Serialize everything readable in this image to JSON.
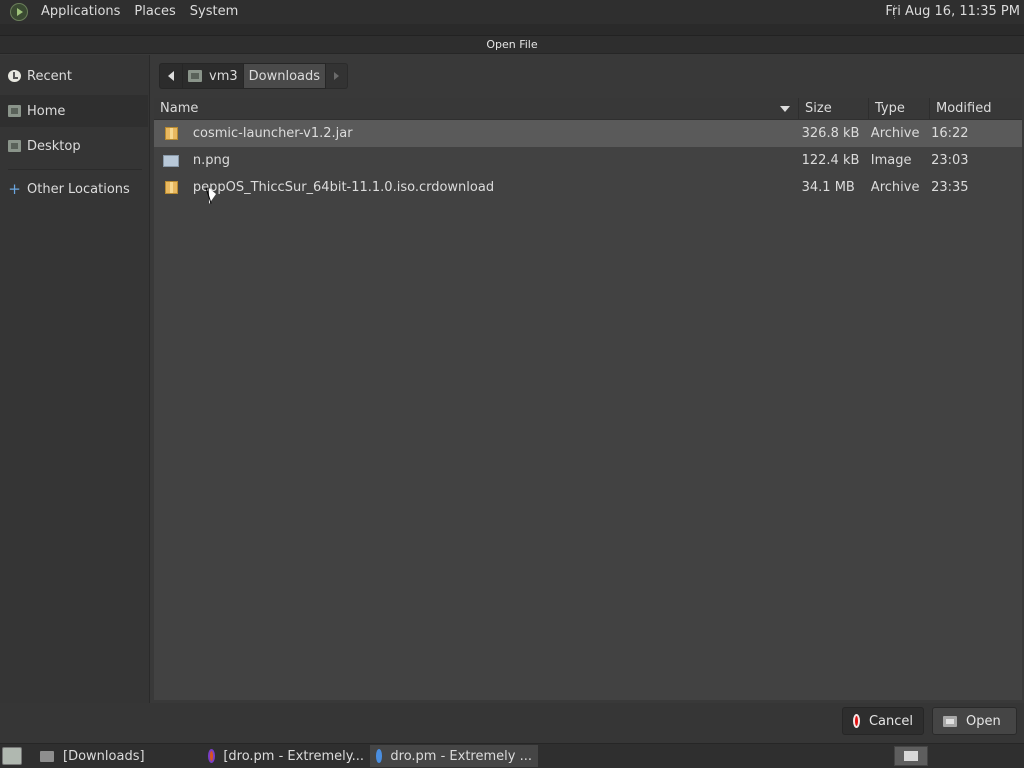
{
  "top_panel": {
    "menus": [
      "Applications",
      "Places",
      "System"
    ],
    "clock": "Fri Aug 16, 11:35 PM"
  },
  "dialog": {
    "title": "Open File",
    "sidebar": {
      "places": [
        {
          "label": "Recent",
          "icon": "clock-icon"
        },
        {
          "label": "Home",
          "icon": "home-folder-icon"
        },
        {
          "label": "Desktop",
          "icon": "desktop-folder-icon"
        },
        {
          "label": "Other Locations",
          "icon": "plus-icon"
        }
      ],
      "active": "Home"
    },
    "pathbar": {
      "segments": [
        "vm3",
        "Downloads"
      ],
      "current": "Downloads"
    },
    "columns": {
      "name": "Name",
      "size": "Size",
      "type": "Type",
      "modified": "Modified"
    },
    "files": [
      {
        "name": "cosmic-launcher-v1.2.jar",
        "size": "326.8 kB",
        "type": "Archive",
        "modified": "16:22",
        "icon": "archive-icon"
      },
      {
        "name": "n.png",
        "size": "122.4 kB",
        "type": "Image",
        "modified": "23:03",
        "icon": "image-icon"
      },
      {
        "name": "peppOS_ThiccSur_64bit-11.1.0.iso.crdownload",
        "size": "34.1 MB",
        "type": "Archive",
        "modified": "23:35",
        "icon": "archive-icon"
      }
    ],
    "buttons": {
      "cancel": "Cancel",
      "open": "Open"
    }
  },
  "taskbar": {
    "tasks": [
      {
        "label": "[Downloads]",
        "icon": "folder-icon"
      },
      {
        "label": "[dro.pm - Extremely...",
        "icon": "firefox-icon"
      },
      {
        "label": "dro.pm - Extremely ...",
        "icon": "chrome-icon"
      }
    ]
  },
  "colors": {
    "cancel_icon": "#e01010",
    "selected_row": "#5a5a5a",
    "other_locations_icon": "#6aa6e0"
  }
}
